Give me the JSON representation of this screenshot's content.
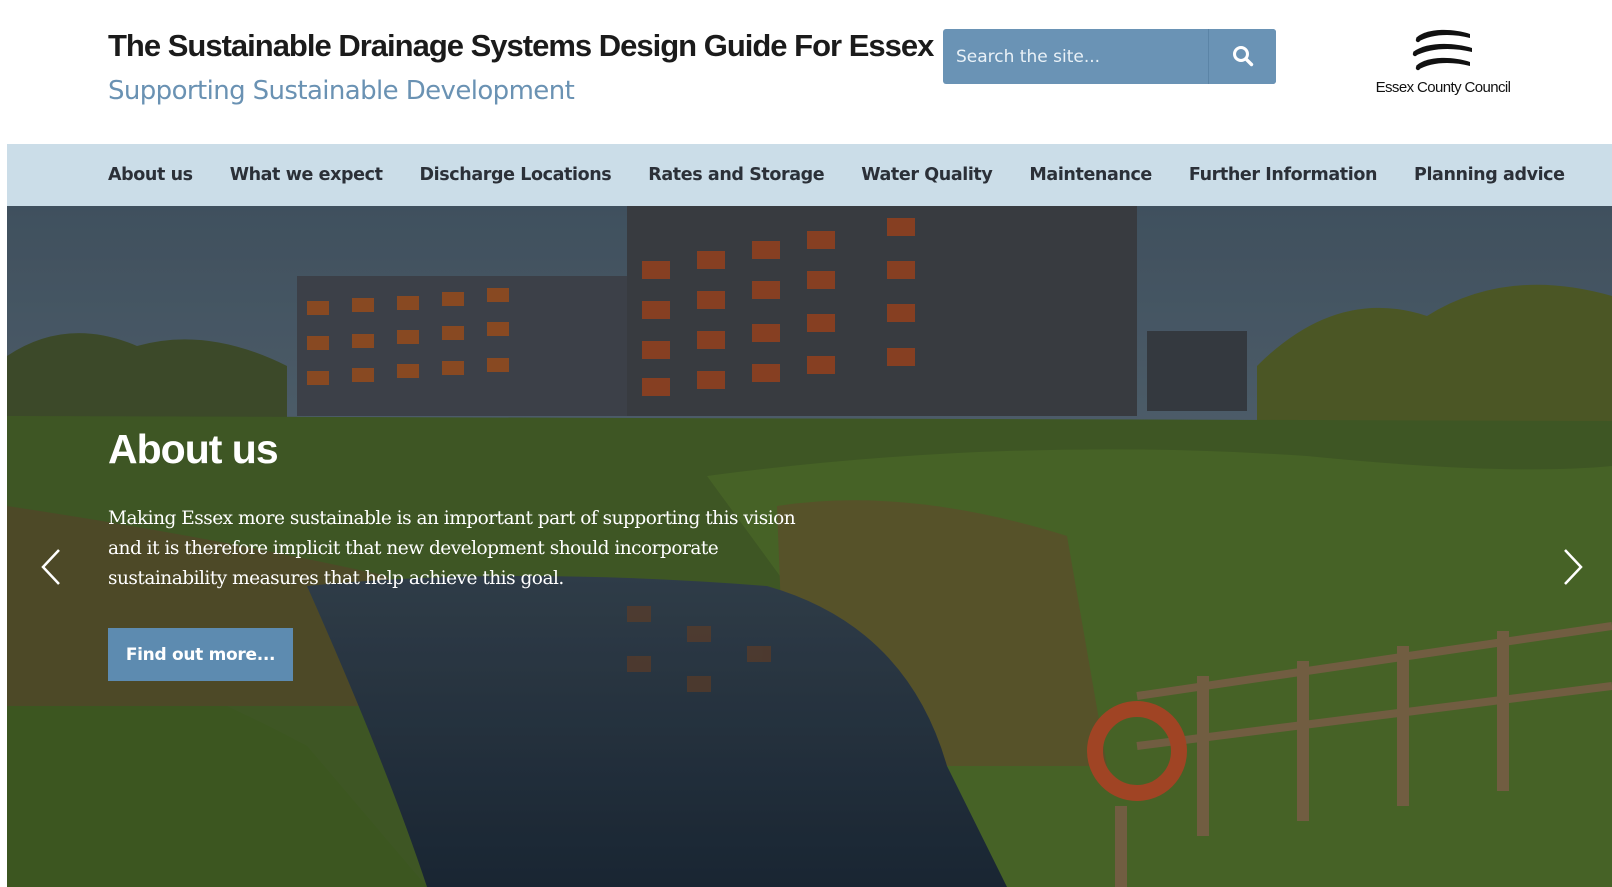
{
  "header": {
    "title": "The Sustainable Drainage Systems Design Guide For Essex",
    "subtitle": "Supporting Sustainable Development",
    "search": {
      "placeholder": "Search the site...",
      "button_icon": "search-icon"
    },
    "logo": {
      "text": "Essex County Council",
      "icon": "ecc-three-seaxes-logo"
    }
  },
  "nav": {
    "items": [
      {
        "label": "About us"
      },
      {
        "label": "What we expect"
      },
      {
        "label": "Discharge Locations"
      },
      {
        "label": "Rates and Storage"
      },
      {
        "label": "Water Quality"
      },
      {
        "label": "Maintenance"
      },
      {
        "label": "Further Information"
      },
      {
        "label": "Planning advice"
      }
    ]
  },
  "hero": {
    "title": "About us",
    "text": "Making Essex more sustainable is an important part of supporting this vision and it is therefore implicit that new development should incorporate sustainability measures that help achieve this goal.",
    "button_label": "Find out more...",
    "prev_icon": "chevron-left-icon",
    "next_icon": "chevron-right-icon"
  },
  "colors": {
    "accent": "#6a93b5",
    "nav_background": "#cbdde8",
    "subtitle": "#6a92b3",
    "button": "#5d8bb0"
  }
}
